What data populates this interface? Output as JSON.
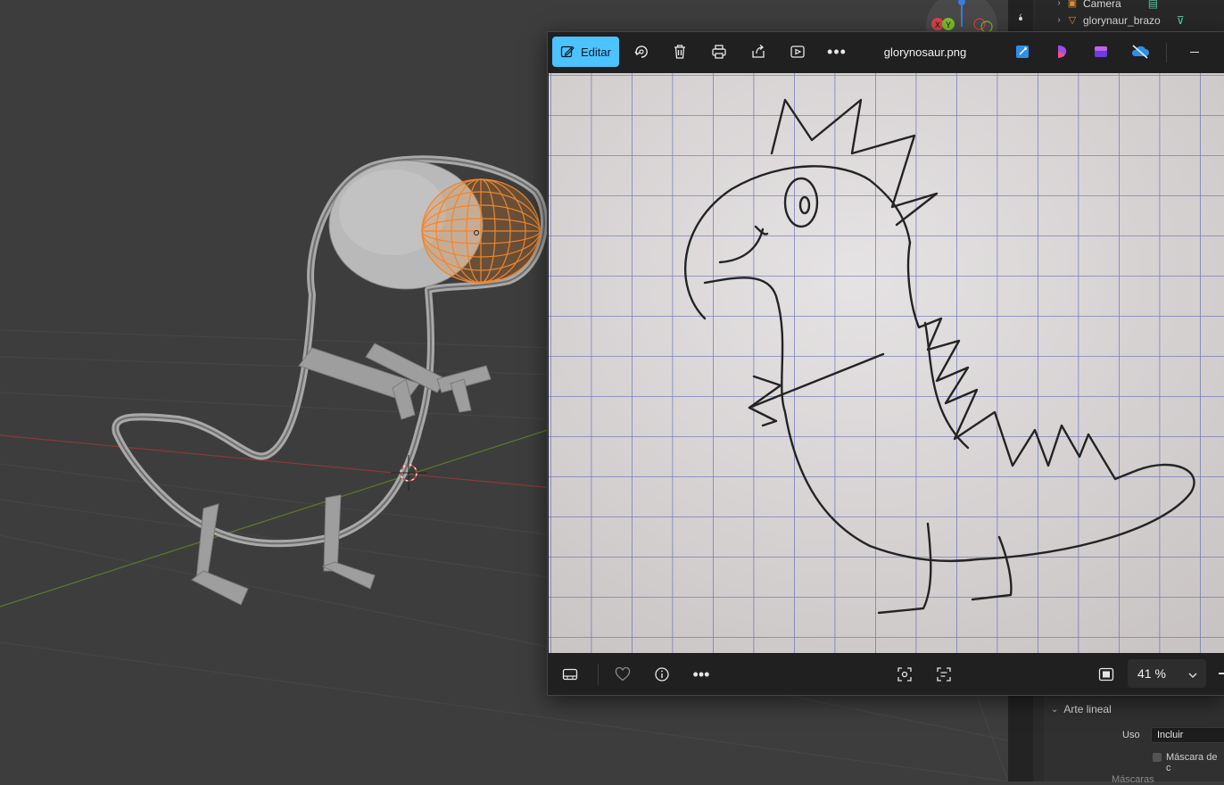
{
  "photos": {
    "title": "glorynosaur.png",
    "edit_label": "Editar",
    "zoom_value": "41 %"
  },
  "outliner": {
    "items": [
      {
        "label": "Camera",
        "icon": "camera-icon"
      },
      {
        "label": "glorynaur_brazo",
        "icon": "mesh-triangle-icon"
      }
    ]
  },
  "properties": {
    "section_title": "Arte lineal",
    "uso_label": "Uso",
    "uso_value": "Incluir",
    "mask_label": "Máscara de c",
    "masks_label": "Máscaras"
  },
  "gizmo": {
    "axis_y": "Y",
    "axis_x": "X"
  },
  "colors": {
    "accent": "#4cc2ff",
    "selection": "#f0862a",
    "viewport_bg": "#3d3d3d"
  }
}
